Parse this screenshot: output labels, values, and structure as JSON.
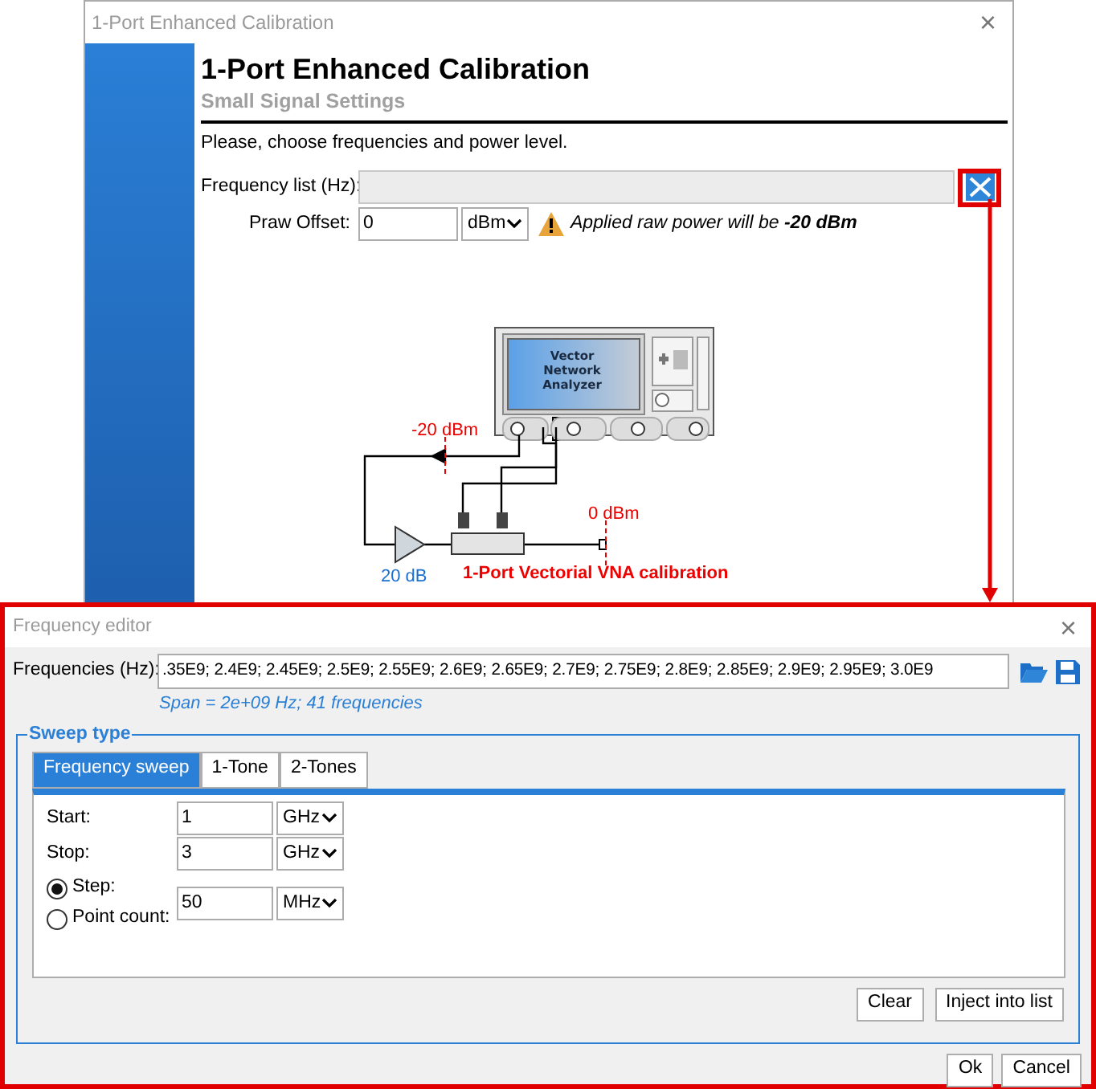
{
  "calibration_window": {
    "title": "1-Port Enhanced Calibration",
    "close": "×",
    "heading": "1-Port Enhanced Calibration",
    "subheading": "Small Signal Settings",
    "instruction": "Please, choose frequencies and power level.",
    "frequency_list": {
      "label": "Frequency list (Hz):"
    },
    "praw_offset": {
      "label": "Praw Offset:",
      "value": "0",
      "unit": "dBm"
    },
    "warning": "Applied raw power will be **-20 dBm**",
    "diagram": {
      "vna_label": [
        "Vector",
        "Network",
        "Analyzer"
      ],
      "input_power": "-20 dBm",
      "output_power": "0 dBm",
      "gain": "20 dB",
      "caption": "1-Port Vectorial VNA calibration"
    }
  },
  "frequency_editor": {
    "title": "Frequency editor",
    "close": "×",
    "frequencies_label": "Frequencies (Hz):",
    "frequencies_value": ".35E9; 2.4E9; 2.45E9; 2.5E9; 2.55E9; 2.6E9; 2.65E9; 2.7E9; 2.75E9; 2.8E9; 2.85E9; 2.9E9; 2.95E9; 3.0E9",
    "span_note": "Span = 2e+09 Hz; 41 frequencies",
    "sweep_type": {
      "title": "Sweep type",
      "tabs": [
        {
          "label": "Frequency sweep",
          "selected": true
        },
        {
          "label": "1-Tone",
          "selected": false
        },
        {
          "label": "2-Tones",
          "selected": false
        }
      ],
      "rows": [
        {
          "kind": "field",
          "label": "Start:",
          "value": "1",
          "unit": "GHz"
        },
        {
          "kind": "field",
          "label": "Stop:",
          "value": "3",
          "unit": "GHz"
        },
        {
          "kind": "radio",
          "options": [
            {
              "label": "Step:",
              "selected": true
            },
            {
              "label": "Point count:",
              "selected": false
            }
          ],
          "value": "50",
          "unit": "MHz"
        }
      ],
      "buttons": [
        "Clear",
        "Inject into list"
      ]
    },
    "buttons": [
      "Ok",
      "Cancel"
    ]
  }
}
